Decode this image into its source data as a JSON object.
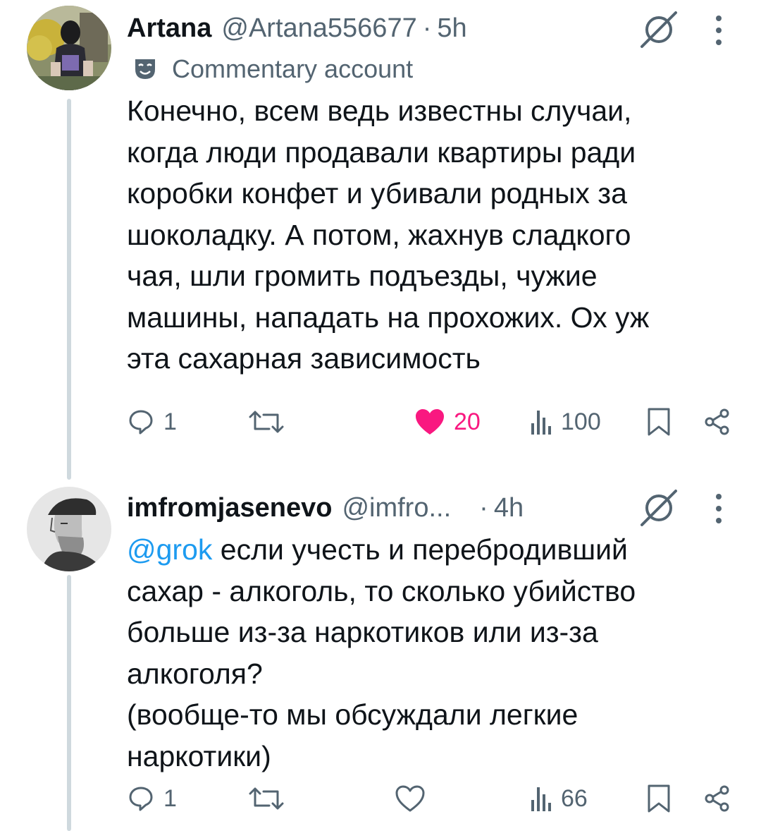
{
  "tweets": [
    {
      "name": "Artana",
      "handle": "@Artana556677",
      "time": "5h",
      "badge": "Commentary account",
      "mention": "",
      "text": "Конечно, всем ведь известны случаи,\nкогда люди продавали квартиры ради\nкоробки конфет и убивали родных за\nшоколадку. А потом, жахнув сладкого\nчая, шли громить подъезды, чужие\nмашины, нападать на прохожих. Ох уж\nэта сахарная зависимость",
      "replies": "1",
      "retweets": "",
      "likes": "20",
      "liked": true,
      "views": "100"
    },
    {
      "name": "imfromjasenevo",
      "handle": "@imfro...",
      "time": "4h",
      "badge": "",
      "mention": "@grok",
      "text": " если учесть и перебродивший\nсахар - алкоголь, то сколько убийство\nбольше из-за наркотиков или из-за\nалкоголя?\n(вообще-то мы обсуждали легкие\nнаркотики)",
      "replies": "1",
      "retweets": "",
      "likes": "",
      "liked": false,
      "views": "66"
    }
  ],
  "colors": {
    "accent": "#1d9bf0",
    "like": "#f91880",
    "secondary_text": "#536471",
    "thread_line": "#cfd9de"
  }
}
